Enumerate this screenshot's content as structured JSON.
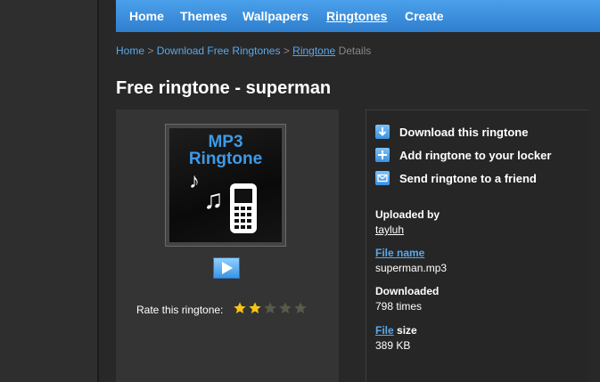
{
  "nav": {
    "items": [
      {
        "label": "Home"
      },
      {
        "label": "Themes"
      },
      {
        "label": "Wallpapers"
      },
      {
        "label": "Ringtones"
      },
      {
        "label": "Create"
      }
    ]
  },
  "breadcrumb": {
    "home": "Home",
    "sep": ">",
    "downloads": "Download Free Ringtones",
    "ringtone": "Ringtone",
    "details": "Details"
  },
  "page": {
    "title": "Free ringtone - superman"
  },
  "thumbnail": {
    "line1": "MP3",
    "line2": "Ringtone"
  },
  "rating": {
    "label": "Rate this ringtone:",
    "value": 2,
    "max": 5
  },
  "actions": [
    {
      "label": "Download this ringtone",
      "icon": "download-icon"
    },
    {
      "label": "Add ringtone to your locker",
      "icon": "plus-icon"
    },
    {
      "label": "Send ringtone to a friend",
      "icon": "envelope-icon"
    }
  ],
  "info": {
    "uploaded_by_label": "Uploaded by",
    "uploaded_by_value": "tayluh",
    "file_name_link": "File name",
    "file_name_value": "superman.mp3",
    "downloaded_label": "Downloaded",
    "downloaded_value": "798 times",
    "file_size_link": "File",
    "file_size_rest": "size",
    "file_size_value": "389 KB"
  },
  "colors": {
    "accent": "#3a95e6",
    "star_on": "#f5c518",
    "star_off": "#5a5a4a"
  }
}
